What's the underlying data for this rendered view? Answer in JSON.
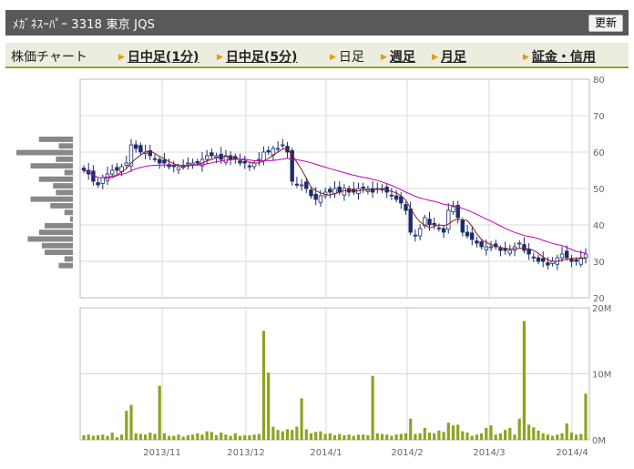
{
  "header": {
    "title": "ﾒｶﾞﾈｽｰﾊﾟｰ  3318  東京 JQS",
    "refresh_label": "更新"
  },
  "tabs": [
    {
      "label": "株価チャート",
      "link": false
    },
    {
      "label": "日中足(1分)",
      "link": true
    },
    {
      "label": "日中足(5分)",
      "link": true
    },
    {
      "label": "日足",
      "link": false,
      "selected": true
    },
    {
      "label": "週足",
      "link": true
    },
    {
      "label": "月足",
      "link": true
    },
    {
      "label": "証金・信用",
      "link": true
    }
  ],
  "colors": {
    "candle": "#1b2d6e",
    "ma_short": "#8b1a1a",
    "ma_long": "#c000c0",
    "volume": "#8fa31e",
    "tab_accent": "#e39b00",
    "header_bg": "#595959",
    "volume_profile": "#888888"
  },
  "chart_data": [
    {
      "type": "candlestick",
      "title": "",
      "x_tick_labels": [
        "2013/11",
        "2013/12",
        "2014/1",
        "2014/2",
        "2014/3",
        "2014/4"
      ],
      "y_ticks": [
        20,
        30,
        40,
        50,
        60,
        70,
        80
      ],
      "ylim": [
        20,
        80
      ],
      "grid": true,
      "closes": [
        55,
        54,
        52,
        51,
        53,
        54,
        55,
        55,
        56,
        57,
        62,
        61,
        60,
        60,
        59,
        58,
        57,
        57,
        56,
        56,
        56,
        56,
        57,
        57,
        57,
        58,
        59,
        59,
        59,
        58,
        59,
        58,
        58,
        57,
        57,
        56,
        57,
        58,
        60,
        60,
        61,
        61,
        62,
        60,
        52,
        51,
        51,
        50,
        48,
        47,
        48,
        49,
        49,
        50,
        49,
        50,
        49,
        49,
        50,
        50,
        50,
        49,
        50,
        50,
        49,
        48,
        47,
        46,
        44,
        38,
        37,
        39,
        42,
        40,
        40,
        39,
        38,
        44,
        45,
        42,
        38,
        37,
        36,
        35,
        34,
        34,
        34,
        34,
        33,
        33,
        33,
        34,
        35,
        33,
        32,
        31,
        30,
        30,
        29,
        30,
        31,
        32,
        31,
        30,
        30,
        31,
        32
      ],
      "volume_profile": [
        12,
        5,
        20,
        6,
        15,
        3,
        12,
        7,
        6,
        15,
        8,
        3,
        1,
        10,
        12,
        16,
        11,
        10,
        3,
        5
      ],
      "series": [
        {
          "name": "",
          "role": "short moving average"
        },
        {
          "name": "",
          "role": "long moving average"
        }
      ]
    },
    {
      "type": "bar",
      "title": "",
      "x_tick_labels": [
        "2013/11",
        "2013/12",
        "2014/1",
        "2014/2",
        "2014/3",
        "2014/4"
      ],
      "y_tick_labels": [
        "0M",
        "10M",
        "20M"
      ],
      "ylim": [
        0,
        20
      ],
      "unit": "M shares",
      "values": [
        0.7,
        0.8,
        0.6,
        0.7,
        0.8,
        0.6,
        1.1,
        0.4,
        0.8,
        4.4,
        5.3,
        1.0,
        0.9,
        0.8,
        1.1,
        0.9,
        8.2,
        1.0,
        0.6,
        0.6,
        0.8,
        0.5,
        0.7,
        0.8,
        1.0,
        0.8,
        1.3,
        1.2,
        0.7,
        1.1,
        0.8,
        0.6,
        1.0,
        0.6,
        0.7,
        0.7,
        0.8,
        0.9,
        16.5,
        10.2,
        2.0,
        1.5,
        1.3,
        1.6,
        1.5,
        2.0,
        6.3,
        1.6,
        1.0,
        1.2,
        1.3,
        0.9,
        1.0,
        0.7,
        0.9,
        0.7,
        0.8,
        0.6,
        0.8,
        0.8,
        0.7,
        9.7,
        1.0,
        0.9,
        0.8,
        0.6,
        0.8,
        0.9,
        1.0,
        3.2,
        0.9,
        1.0,
        1.8,
        1.1,
        1.0,
        1.4,
        1.2,
        2.6,
        2.2,
        2.3,
        1.3,
        1.1,
        0.6,
        0.8,
        1.0,
        1.8,
        2.2,
        0.8,
        1.0,
        1.5,
        1.8,
        0.8,
        3.2,
        18.0,
        2.3,
        1.9,
        1.4,
        1.0,
        0.8,
        0.6,
        0.8,
        1.0,
        2.5,
        1.1,
        0.8,
        0.9,
        7.0
      ]
    }
  ]
}
